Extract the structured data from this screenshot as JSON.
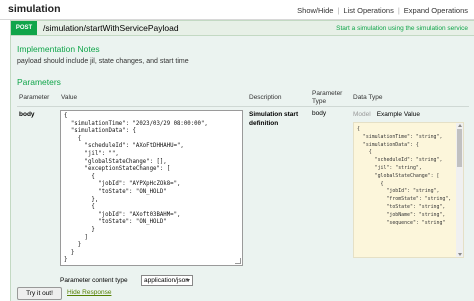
{
  "header": {
    "title": "simulation",
    "links": [
      "Show/Hide",
      "List Operations",
      "Expand Operations"
    ]
  },
  "operation": {
    "method": "POST",
    "path": "/simulation/startWithServicePayload",
    "summary": "Start a simulation using the simulation service",
    "method_color": "#10a54a"
  },
  "notes": {
    "heading": "Implementation Notes",
    "text": "payload should include jil, state changes, and start time"
  },
  "parameters": {
    "heading": "Parameters",
    "columns": [
      "Parameter",
      "Value",
      "Description",
      "Parameter Type",
      "Data Type"
    ],
    "row": {
      "name": "body",
      "value": "{\n  \"simulationTime\": \"2023/03/29 08:00:00\",\n  \"simulationData\": {\n    {\n      \"scheduleId\": \"AXoFtDHHAHU=\",\n      \"jil\": \"\",\n      \"globalStateChange\": [],\n      \"exceptionStateChange\": [\n        {\n          \"jobId\": \"AYPXpHcZOk8=\",\n          \"toState\": \"ON_HOLD\"\n        },\n        {\n          \"jobId\": \"AXoft03BAHM=\",\n          \"toState\": \"ON_HOLD\"\n        }\n      ]\n    }\n  }\n}",
      "description": "Simulation start definition",
      "param_type": "body"
    }
  },
  "data_type": {
    "tabs": [
      "Model",
      "Example Value"
    ],
    "example": "{\n  \"simulationTime\": \"string\",\n  \"simulationData\": {\n    {\n      \"scheduleId\": \"string\",\n      \"jil\": \"string\",\n      \"globalStateChange\": [\n        {\n          \"jobId\": \"string\",\n          \"fromState\": \"string\",\n          \"toState\": \"string\",\n          \"jobName\": \"string\",\n          \"sequence\": \"string\""
  },
  "content_type": {
    "label": "Parameter content type",
    "selected": "application/json"
  },
  "actions": {
    "try_it": "Try it out!",
    "hide_response": "Hide Response"
  }
}
